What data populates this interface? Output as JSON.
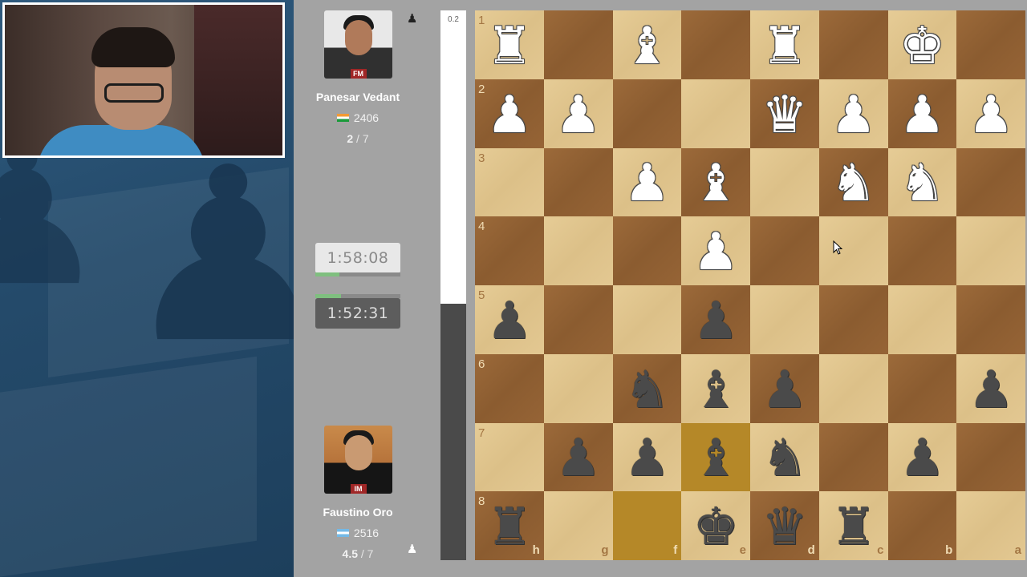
{
  "top_player": {
    "name": "Panesar Vedant",
    "title": "FM",
    "rating": "2406",
    "score": "2",
    "score_total": "/ 7",
    "flag": "india",
    "clock": "1:58:08",
    "clock_progress": 0.28,
    "side_icon": "♟"
  },
  "bottom_player": {
    "name": "Faustino Oro",
    "title": "IM",
    "rating": "2516",
    "score": "4.5",
    "score_total": "/ 7",
    "flag": "argentina",
    "clock": "1:52:31",
    "clock_progress": 0.3,
    "side_icon": "♟"
  },
  "eval": {
    "value": "0.2",
    "white_fraction": 0.534
  },
  "board": {
    "rank_labels": [
      "1",
      "2",
      "3",
      "4",
      "5",
      "6",
      "7",
      "8"
    ],
    "file_labels": [
      "h",
      "g",
      "f",
      "e",
      "d",
      "c",
      "b",
      "a"
    ],
    "highlight": [
      [
        6,
        3
      ],
      [
        7,
        2
      ]
    ],
    "rows": [
      [
        "wR",
        "",
        "wB",
        "",
        "wR",
        "",
        "wK",
        ""
      ],
      [
        "wP",
        "wP",
        "",
        "",
        "wQ",
        "wP",
        "wP",
        "wP"
      ],
      [
        "",
        "",
        "wP",
        "wB",
        "",
        "wN",
        "wN",
        ""
      ],
      [
        "",
        "",
        "",
        "wP",
        "",
        "",
        "",
        ""
      ],
      [
        "bP",
        "",
        "",
        "bP",
        "",
        "",
        "",
        ""
      ],
      [
        "",
        "",
        "bN",
        "bB",
        "bP",
        "",
        "",
        "bP"
      ],
      [
        "",
        "bP",
        "bP",
        "bB",
        "bN",
        "",
        "bP",
        ""
      ],
      [
        "bR",
        "",
        "",
        "bK",
        "bQ",
        "bR",
        "",
        ""
      ]
    ]
  },
  "icons": {
    "webcam": "streamer-webcam",
    "cursor": "mouse-cursor-icon"
  },
  "colors": {
    "light_square": "#dcc088",
    "dark_square": "#8b5c30",
    "highlight_light": "#cfa84f",
    "highlight_dark": "#b58828",
    "title_badge": "#a02727"
  }
}
